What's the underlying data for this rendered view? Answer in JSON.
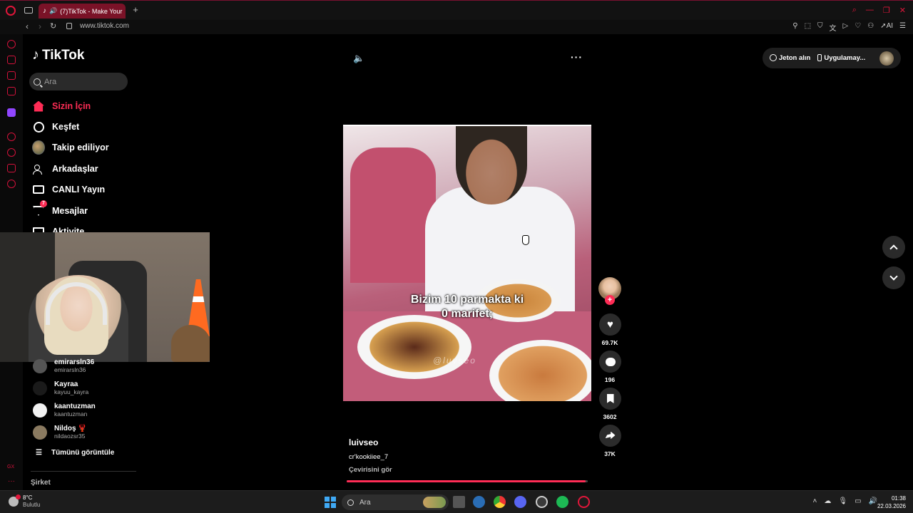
{
  "browser": {
    "tab_title": "(7)TikTok - Make Your",
    "url": "www.tiktok.com",
    "toolbar_ai_label": "AI"
  },
  "sidebar": {
    "logo": "TikTok",
    "search_placeholder": "Ara",
    "nav": [
      {
        "label": "Sizin İçin",
        "icon": "home-icon",
        "active": true
      },
      {
        "label": "Keşfet",
        "icon": "compass-icon"
      },
      {
        "label": "Takip ediliyor",
        "icon": "avatar"
      },
      {
        "label": "Arkadaşlar",
        "icon": "friends-icon"
      },
      {
        "label": "CANLI Yayın",
        "icon": "live-tv-icon"
      },
      {
        "label": "Mesajlar",
        "icon": "messages-icon",
        "badge": "7"
      },
      {
        "label": "Aktivite",
        "icon": "activity-icon"
      }
    ],
    "following": [
      {
        "name": "emirarsln36",
        "handle": "emirarsln36"
      },
      {
        "name": "Kayraa",
        "handle": "kayuu_kayra"
      },
      {
        "name": "kaantuzman",
        "handle": "kaantuzman"
      },
      {
        "name": "Nildoş 🦞",
        "handle": "nildaozsr35"
      }
    ],
    "see_all": "Tümünü görüntüle",
    "company": "Şirket"
  },
  "video": {
    "caption_line1": "Bizim 10 parmakta ki",
    "caption_line2": "0 marifet;",
    "watermark": "@luvseo",
    "author": "luivseo",
    "description": "cr'kookiiee_7",
    "see_translation": "Çevirisini gör",
    "progress_percent": 99
  },
  "actions": {
    "likes": "69.7K",
    "comments": "196",
    "saves": "3602",
    "shares": "37K"
  },
  "topright": {
    "coins_label": "Jeton alın",
    "app_label": "Uygulamay..."
  },
  "taskbar": {
    "weather_temp": "8°C",
    "weather_desc": "Bulutlu",
    "search_placeholder": "Ara",
    "time": "01:38",
    "date": "22.03.2026"
  },
  "colors": {
    "accent": "#fe2c55",
    "opera_red": "#e0163a",
    "background": "#000000"
  }
}
